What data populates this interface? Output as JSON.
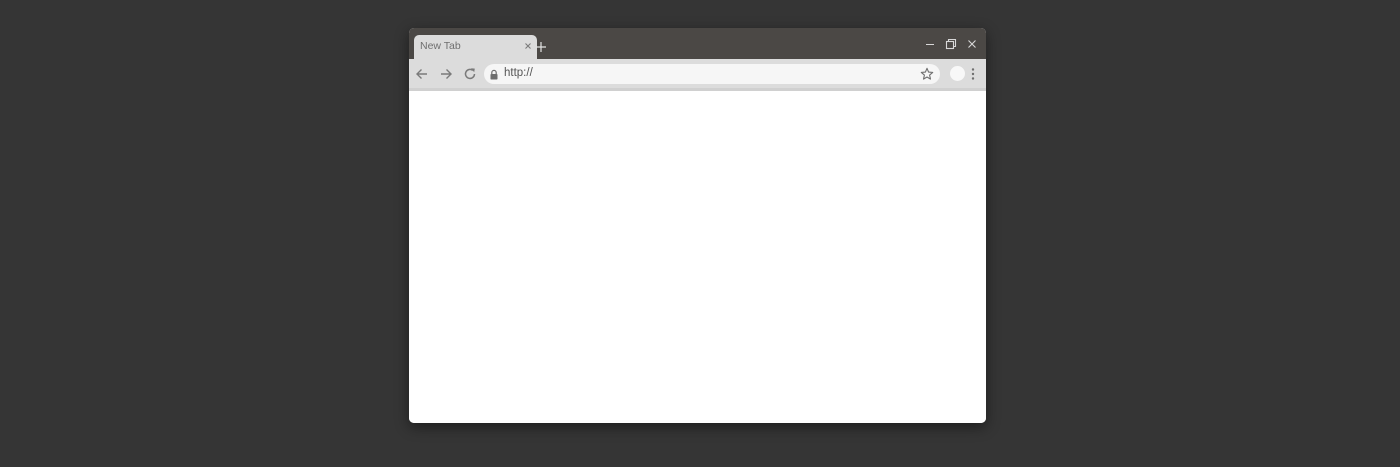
{
  "browser": {
    "tab": {
      "title": "New Tab",
      "close_icon": "close-icon"
    },
    "new_tab_icon": "plus-icon",
    "window_controls": [
      "minimize-icon",
      "restore-icon",
      "close-icon"
    ],
    "toolbar": {
      "back_icon": "arrow-left-icon",
      "forward_icon": "arrow-right-icon",
      "reload_icon": "reload-icon",
      "address": {
        "lock_icon": "lock-icon",
        "url": "http://",
        "bookmark_icon": "star-icon"
      },
      "profile_icon": "avatar",
      "menu_icon": "kebab-menu-icon"
    },
    "page": {
      "content": ""
    }
  },
  "colors": {
    "desktop_bg": "#353535",
    "titlebar_bg": "#4b4845",
    "tab_bg": "#dcdcdc",
    "toolbar_bg": "#dcdcdc",
    "omnibox_bg": "#f6f6f6",
    "page_bg": "#ffffff",
    "icon_light": "#e8e8e8",
    "icon_dark": "#6f6f6f"
  }
}
